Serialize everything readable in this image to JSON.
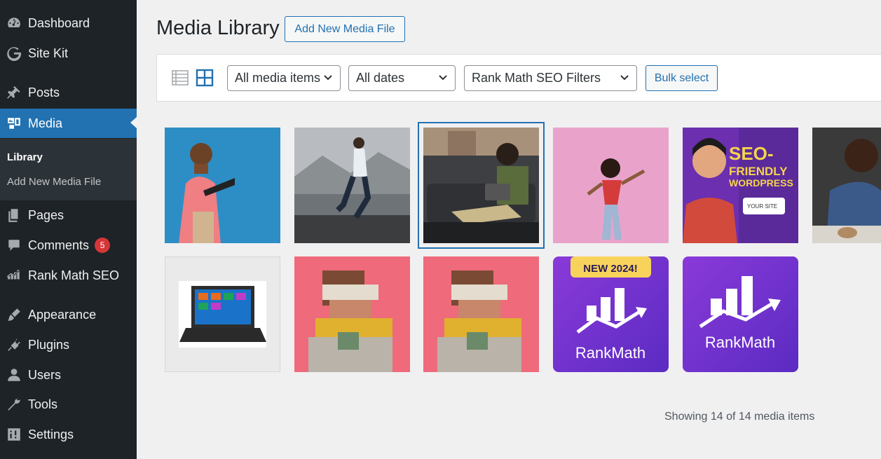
{
  "sidebar": {
    "items": [
      {
        "label": "Dashboard",
        "icon": "dashboard-icon"
      },
      {
        "label": "Site Kit",
        "icon": "google-g-icon"
      },
      {
        "label": "Posts",
        "icon": "pin-icon"
      },
      {
        "label": "Media",
        "icon": "media-icon"
      },
      {
        "label": "Pages",
        "icon": "pages-icon"
      },
      {
        "label": "Comments",
        "icon": "comment-icon",
        "badge": "5"
      },
      {
        "label": "Rank Math SEO",
        "icon": "rank-math-icon"
      },
      {
        "label": "Appearance",
        "icon": "brush-icon"
      },
      {
        "label": "Plugins",
        "icon": "plugin-icon"
      },
      {
        "label": "Users",
        "icon": "user-icon"
      },
      {
        "label": "Tools",
        "icon": "wrench-icon"
      },
      {
        "label": "Settings",
        "icon": "settings-icon"
      }
    ],
    "submenu": [
      {
        "label": "Library"
      },
      {
        "label": "Add New Media File"
      }
    ]
  },
  "header": {
    "title": "Media Library",
    "add_new_label": "Add New Media File"
  },
  "toolbar": {
    "filter_type": "All media items",
    "filter_date": "All dates",
    "filter_seo": "Rank Math SEO Filters",
    "bulk_label": "Bulk select"
  },
  "grid": {
    "thumbnails": [
      {
        "alt": "Man holding laptop on blue background"
      },
      {
        "alt": "Man running on mountain road"
      },
      {
        "alt": "Boy on couch with tablet",
        "selected": true
      },
      {
        "alt": "Woman dancing on pink background"
      },
      {
        "alt": "SEO-Friendly WordPress graphic",
        "text": [
          "SEO-",
          "FRIENDLY",
          "WORDPRESS",
          "YOUR SITE"
        ]
      },
      {
        "alt": "Man at desk"
      },
      {
        "alt": "Laptop product image"
      },
      {
        "alt": "Pixelated portrait 1"
      },
      {
        "alt": "Pixelated portrait 2"
      },
      {
        "alt": "RankMath NEW 2024 logo",
        "text": [
          "NEW 2024!",
          "RankMath"
        ]
      },
      {
        "alt": "RankMath logo",
        "text": [
          "RankMath"
        ]
      }
    ]
  },
  "footer": {
    "count_text": "Showing 14 of 14 media items"
  },
  "colors": {
    "accent": "#2271b1",
    "sidebar_bg": "#1d2327",
    "badge": "#d63638"
  }
}
